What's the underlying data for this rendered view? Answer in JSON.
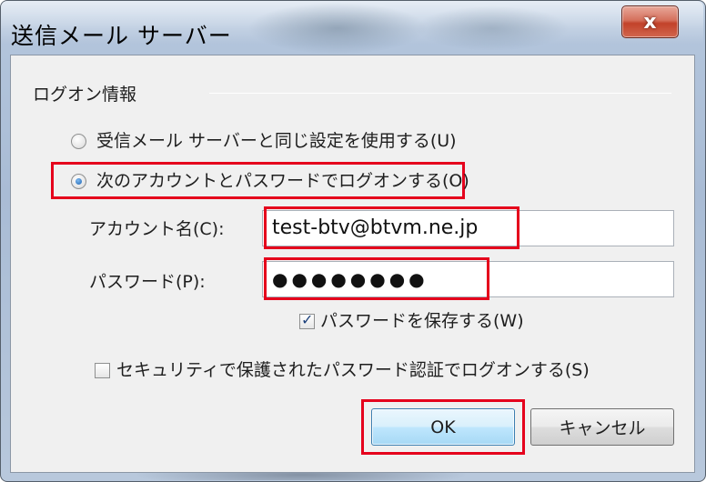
{
  "window": {
    "title": "送信メール サーバー",
    "close_glyph": "x"
  },
  "group": {
    "label": "ログオン情報"
  },
  "options": [
    {
      "label": "受信メール サーバーと同じ設定を使用する(U)",
      "selected": false
    },
    {
      "label": "次のアカウントとパスワードでログオンする(O)",
      "selected": true
    }
  ],
  "account": {
    "label": "アカウント名(C):",
    "value": "test-btv@btvm.ne.jp"
  },
  "password": {
    "label": "パスワード(P):",
    "value": "●●●●●●●●"
  },
  "save_password": {
    "label": "パスワードを保存する(W)",
    "checked": true
  },
  "spa": {
    "label": "セキュリティで保護されたパスワード認証でログオンする(S)",
    "checked": false
  },
  "buttons": {
    "ok": "OK",
    "cancel": "キャンセル"
  },
  "colors": {
    "highlight": "#e5001c",
    "dialog_bg": "#f0f0f0",
    "close_button": "#c2422a"
  }
}
